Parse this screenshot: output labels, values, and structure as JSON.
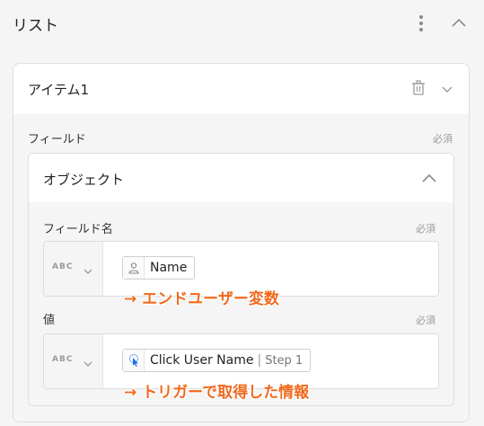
{
  "header": {
    "title": "リスト",
    "menu_icon": "kebab-vertical-icon",
    "collapse_icon": "chevron-up-icon"
  },
  "item": {
    "label": "アイテム1",
    "delete_icon": "trash-icon",
    "expand_icon": "chevron-down-icon",
    "field_label": "フィールド",
    "required": "必須",
    "object": {
      "title": "オブジェクト",
      "collapse_icon": "chevron-up-icon",
      "field_name": {
        "label": "フィールド名",
        "required": "必須",
        "type": "ABC",
        "chip_icon": "person-icon",
        "chip_text": "Name",
        "annotation": "→ エンドユーザー変数"
      },
      "value": {
        "label": "値",
        "required": "必須",
        "type": "ABC",
        "chip_icon": "click-cursor-icon",
        "chip_text": "Click User Name",
        "chip_separator": "|",
        "chip_step": "Step 1",
        "annotation": "→ トリガーで取得した情報"
      }
    }
  },
  "colors": {
    "annotation": "#ef6a1e",
    "click_icon": "#1a73e8",
    "panel_bg": "#f5f5f5",
    "card_bg": "#ffffff"
  }
}
